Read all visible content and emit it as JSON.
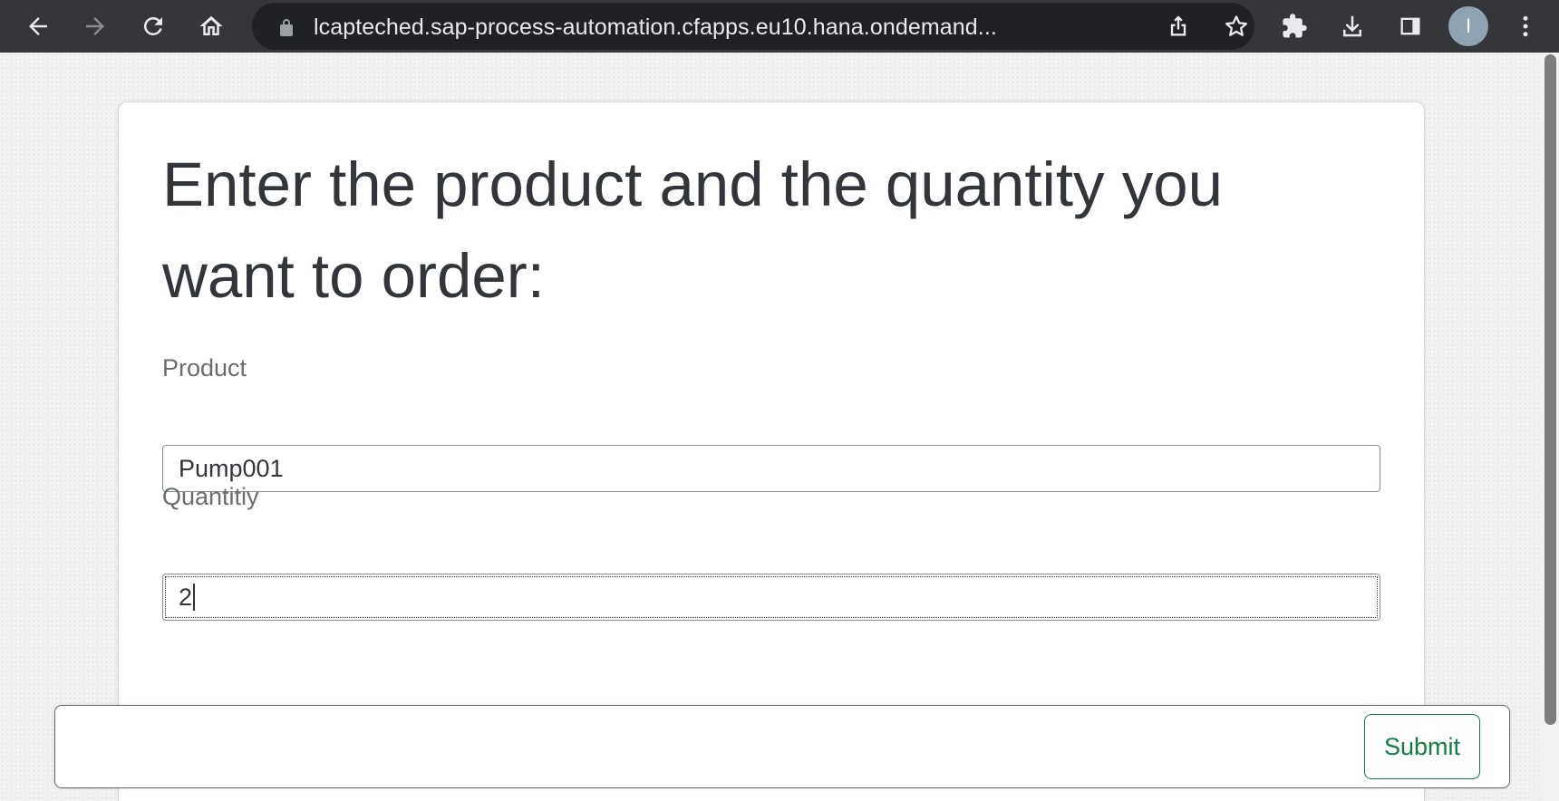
{
  "browser": {
    "url": "lcapteched.sap-process-automation.cfapps.eu10.hana.ondemand...",
    "profile_initial": "I",
    "icons": {
      "back": "arrow-left-icon",
      "forward": "arrow-right-icon",
      "reload": "reload-icon",
      "home": "home-icon",
      "lock": "lock-icon",
      "share": "share-icon",
      "bookmark": "star-icon",
      "extensions": "puzzle-icon",
      "downloads": "download-icon",
      "side_panel": "side-panel-icon",
      "menu": "kebab-menu-icon"
    }
  },
  "form": {
    "title": "Enter the product and the quantity you want to order:",
    "product_label": "Product",
    "product_value": "Pump001",
    "quantity_label": "Quantitiy",
    "quantity_value": "2"
  },
  "footer": {
    "submit_label": "Submit"
  },
  "colors": {
    "toolbar": "#35363a",
    "omnibox": "#202124",
    "accent_green": "#107e3e",
    "text": "#32363a",
    "label": "#6a6d70"
  }
}
